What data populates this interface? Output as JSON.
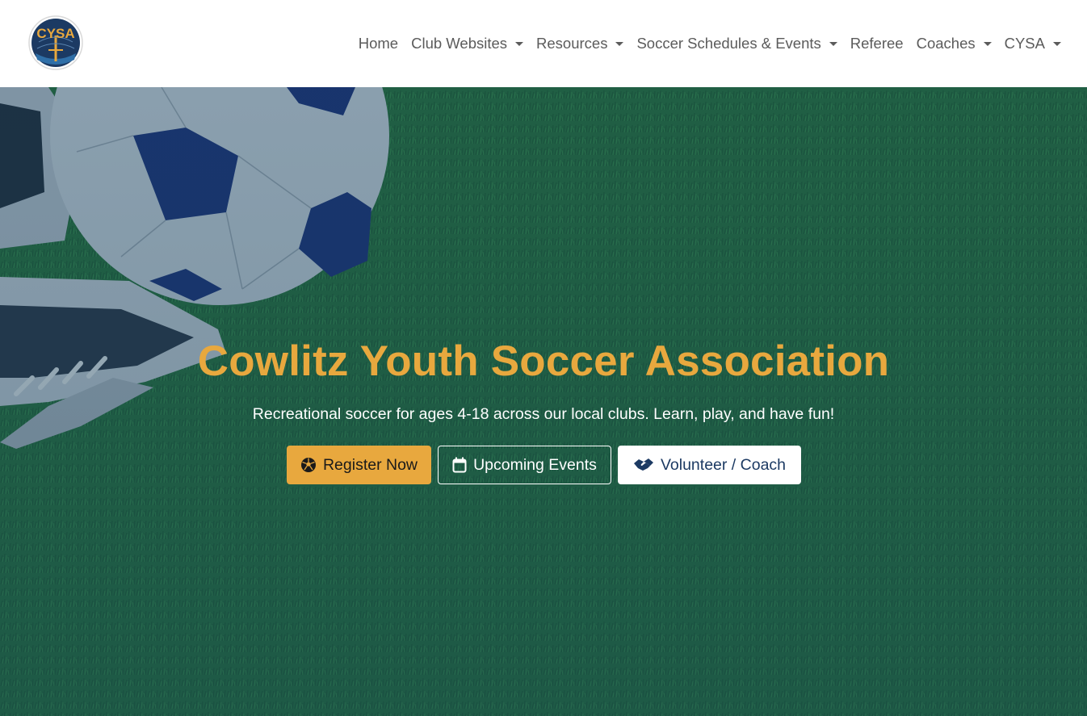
{
  "brand": {
    "logo_text": "CYSA",
    "icon": "cysa-logo-icon",
    "colors": {
      "navy": "#1c3a63",
      "gold": "#e8a83e"
    }
  },
  "nav": {
    "items": [
      {
        "label": "Home",
        "dropdown": false
      },
      {
        "label": "Club Websites",
        "dropdown": true
      },
      {
        "label": "Resources",
        "dropdown": true
      },
      {
        "label": "Soccer Schedules & Events",
        "dropdown": true
      },
      {
        "label": "Referee",
        "dropdown": false
      },
      {
        "label": "Coaches",
        "dropdown": true
      },
      {
        "label": "CYSA",
        "dropdown": true
      }
    ]
  },
  "hero": {
    "title": "Cowlitz Youth Soccer Association",
    "subtitle": "Recreational soccer for ages 4-18 across our local clubs. Learn, play, and have fun!",
    "buttons": {
      "register": {
        "label": "Register Now",
        "icon": "soccer-ball-icon"
      },
      "events": {
        "label": "Upcoming Events",
        "icon": "calendar-icon"
      },
      "volunteer": {
        "label": "Volunteer / Coach",
        "icon": "handshake-icon"
      }
    },
    "colors": {
      "title": "#e8a83e",
      "overlay": "#1b4a5a",
      "grass": "#2e7d3a"
    }
  }
}
